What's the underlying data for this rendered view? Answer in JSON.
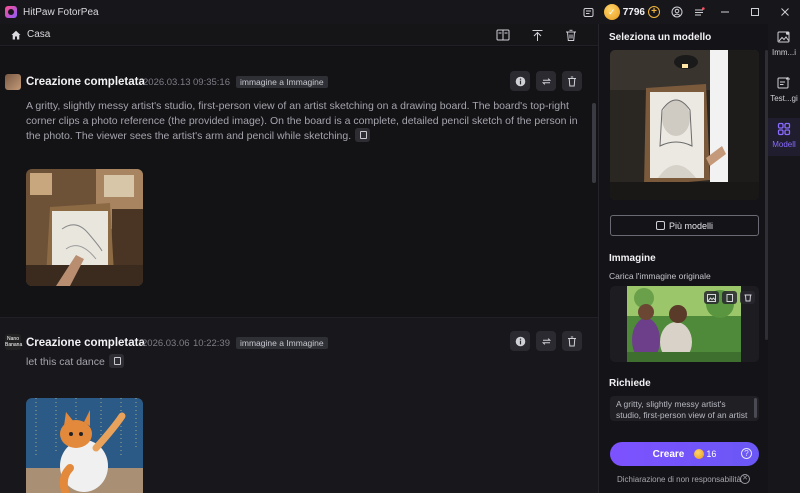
{
  "app": {
    "title": "HitPaw FotorPea",
    "credits": "7796"
  },
  "toolbar": {
    "breadcrumb": "Casa"
  },
  "feed": {
    "items": [
      {
        "title": "Creazione completata",
        "date": "2026.03.13",
        "time": "09:35:16",
        "tag": "immagine a Immagine",
        "prompt": "A gritty, slightly messy artist's studio, first-person view of an artist sketching on a drawing board. The board's top-right corner clips a photo reference (the provided image). On the board is a complete, detailed pencil sketch of the person in the photo. The viewer sees the artist's arm and pencil while sketching."
      },
      {
        "title": "Creazione completata",
        "date": "2026.03.06",
        "time": "10:22:39",
        "tag": "immagine a Immagine",
        "prompt": "let this cat dance",
        "avatar_text": "Nano Banana"
      }
    ]
  },
  "panel": {
    "model_title": "Seleziona un modello",
    "more_models": "Più modelli",
    "image_title": "Immagine",
    "upload_label": "Carica l'immagine originale",
    "prompt_title": "Richiede",
    "prompt_value": "A gritty, slightly messy artist's studio, first-person view of an artist",
    "create_label": "Creare",
    "create_cost": "16",
    "help": "?",
    "disclaimer": "Dichiarazione di non responsabilità"
  },
  "rail": {
    "items": [
      {
        "label": "Imm...i"
      },
      {
        "label": "Test...gi"
      },
      {
        "label": "Modell"
      }
    ]
  },
  "colors": {
    "accent": "#7d52ff",
    "coin": "#f2b63c"
  }
}
